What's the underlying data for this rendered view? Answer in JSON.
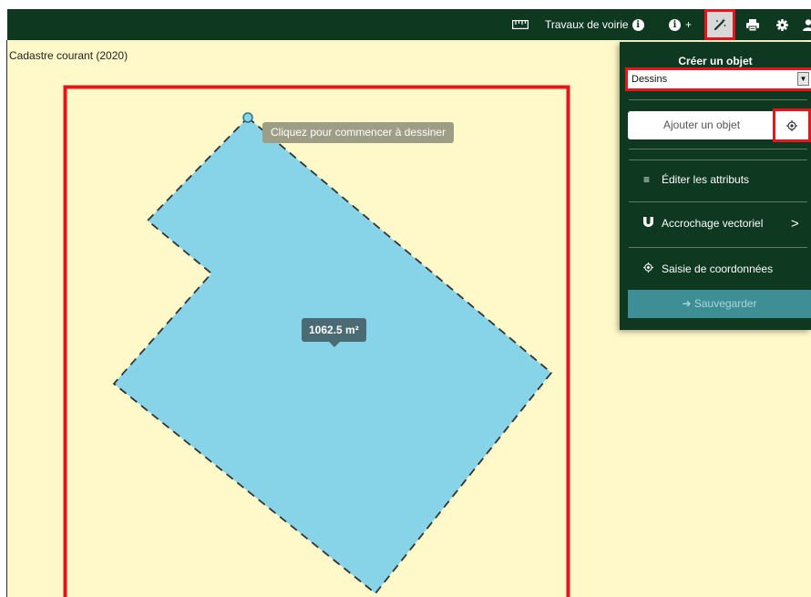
{
  "toolbar": {
    "ruler_icon": "ruler-icon",
    "project_label": "Travaux de voirie",
    "info_icon": "info-icon",
    "info_plus": "+",
    "magic_icon": "magic-wand-icon",
    "print_icon": "print-icon",
    "gear_icon": "gear-icon",
    "user_icon": "user-icon",
    "background_color": "#0e3820"
  },
  "map": {
    "layer_label": "Cadastre courant (2020)",
    "hint": "Cliquez pour commencer à dessiner",
    "area": "1062.5 m²",
    "background_color": "#fff9c9",
    "polygon_fill": "#87d3e8",
    "frame_color": "#e8141b"
  },
  "panel": {
    "title": "Créer un objet",
    "select_value": "Dessins",
    "add_object": "Ajouter un objet",
    "items": [
      {
        "label": "Éditer les attributs",
        "icon": "list-icon"
      },
      {
        "label": "Accrochage vectoriel",
        "icon": "magnet-icon"
      },
      {
        "label": "Saisie de coordonnées",
        "icon": "crosshair-icon"
      }
    ],
    "save": "Sauvegarder",
    "save_color": "#3e8f95"
  }
}
